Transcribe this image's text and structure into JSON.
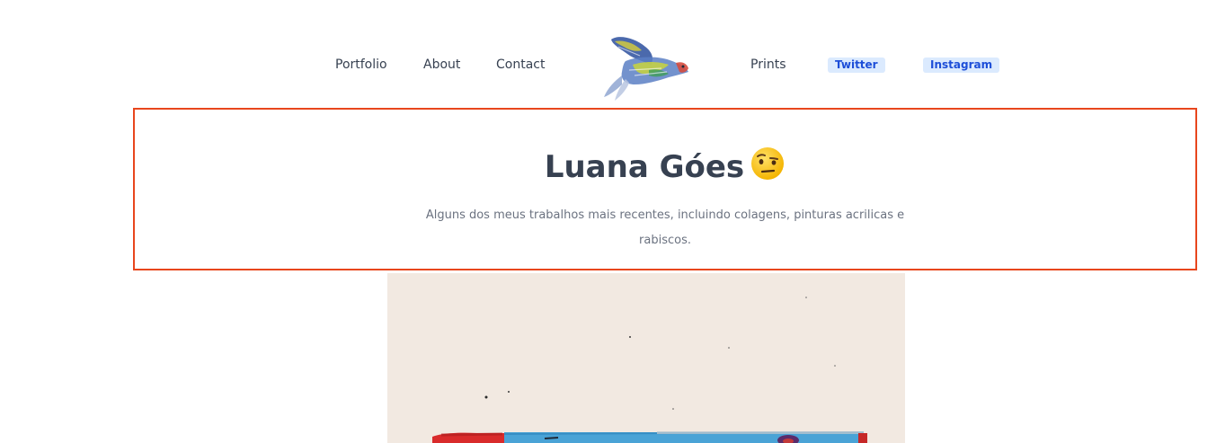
{
  "nav": {
    "portfolio": "Portfolio",
    "about": "About",
    "contact": "Contact",
    "prints": "Prints",
    "twitter": "Twitter",
    "instagram": "Instagram"
  },
  "hero": {
    "title": "Luana Góes",
    "emoji_icon": "face-with-raised-eyebrow-icon",
    "description": "Alguns dos meus trabalhos mais recentes, incluindo colagens, pinturas acrilicas e rabiscos."
  },
  "colors": {
    "text": "#374151",
    "muted": "#6b7280",
    "badge_bg": "#dbeafe",
    "badge_text": "#1d4ed8",
    "highlight_border": "#e8461d",
    "artwork_paper": "#f2e9e1"
  },
  "logo_icon": "bird-painting-logo"
}
